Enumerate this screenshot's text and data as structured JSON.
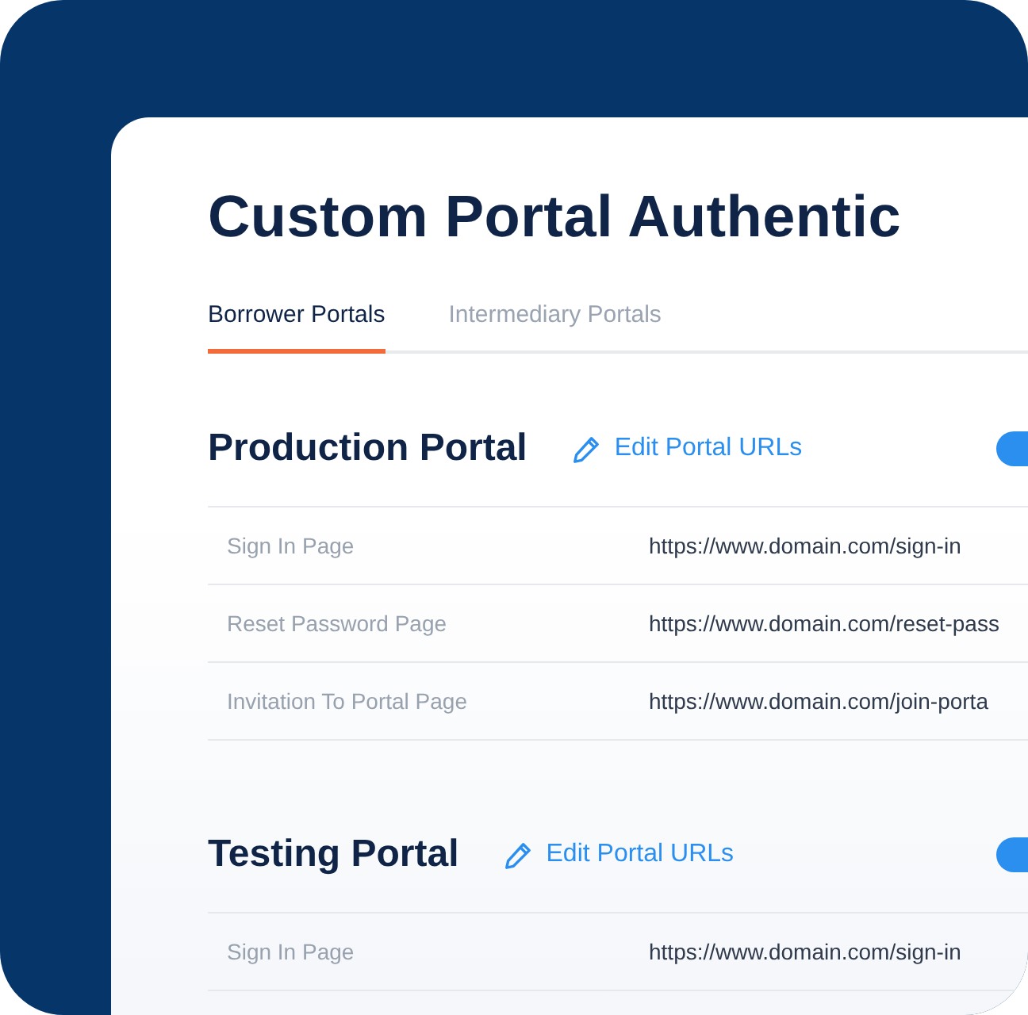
{
  "title": "Custom Portal Authentic",
  "tabs": [
    {
      "label": "Borrower Portals",
      "selected": true
    },
    {
      "label": "Intermediary Portals",
      "selected": false
    }
  ],
  "portals": [
    {
      "name": "Production Portal",
      "edit_link": "Edit Portal URLs",
      "on": true,
      "rows": [
        {
          "label": "Sign In Page",
          "url": "https://www.domain.com/sign-in"
        },
        {
          "label": "Reset Password Page",
          "url": "https://www.domain.com/reset-pass"
        },
        {
          "label": "Invitation To Portal Page",
          "url": "https://www.domain.com/join-porta"
        }
      ]
    },
    {
      "name": "Testing Portal",
      "edit_link": "Edit Portal URLs",
      "on": true,
      "rows": [
        {
          "label": "Sign In Page",
          "url": "https://www.domain.com/sign-in"
        }
      ]
    }
  ]
}
